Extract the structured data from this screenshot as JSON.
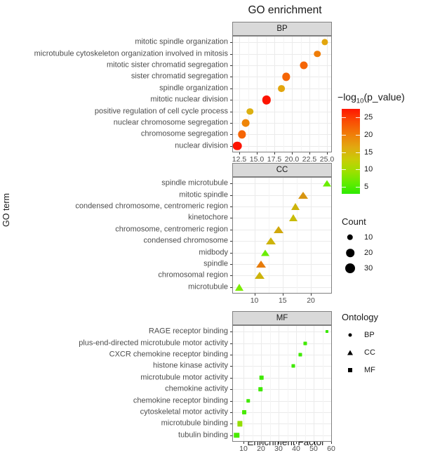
{
  "chart_data": {
    "type": "scatter",
    "title": "GO enrichment",
    "xlabel": "Enrichment Factor",
    "ylabel": "GO term",
    "grid": true,
    "facets": [
      {
        "name": "BP",
        "strip_label": "BP",
        "xlim": [
          11.6,
          25.6
        ],
        "xticks": [
          12.5,
          15.0,
          17.5,
          20.0,
          22.5,
          25.0
        ],
        "xtick_labels": [
          "12.5",
          "15.0",
          "17.5",
          "20.0",
          "22.5",
          "25.0"
        ],
        "points": [
          {
            "term": "mitotic spindle organization",
            "x": 24.7,
            "p": 20.0,
            "count": 12,
            "color": "#e2a60e"
          },
          {
            "term": "microtubule cytoskeleton organization involved in mitosis",
            "x": 23.6,
            "p": 21.5,
            "count": 13,
            "color": "#ef7d08"
          },
          {
            "term": "mitotic sister chromatid segregation",
            "x": 21.7,
            "p": 23.0,
            "count": 18,
            "color": "#f56505"
          },
          {
            "term": "sister chromatid segregation",
            "x": 19.2,
            "p": 23.0,
            "count": 19,
            "color": "#f56505"
          },
          {
            "term": "spindle organization",
            "x": 18.5,
            "p": 20.0,
            "count": 14,
            "color": "#e2a60e"
          },
          {
            "term": "mitotic nuclear division",
            "x": 16.4,
            "p": 27.0,
            "count": 23,
            "color": "#fd1400"
          },
          {
            "term": "positive regulation of cell cycle process",
            "x": 14.0,
            "p": 19.0,
            "count": 13,
            "color": "#dcb011"
          },
          {
            "term": "nuclear chromosome segregation",
            "x": 13.4,
            "p": 21.0,
            "count": 17,
            "color": "#ef8507"
          },
          {
            "term": "chromosome segregation",
            "x": 12.9,
            "p": 23.0,
            "count": 19,
            "color": "#f56505"
          },
          {
            "term": "nuclear division",
            "x": 12.2,
            "p": 27.0,
            "count": 24,
            "color": "#fd1400"
          }
        ]
      },
      {
        "name": "CC",
        "strip_label": "CC",
        "xlim": [
          6.2,
          23.6
        ],
        "xticks": [
          10,
          15,
          20
        ],
        "xtick_labels": [
          "10",
          "15",
          "20"
        ],
        "points": [
          {
            "term": "spindle microtubule",
            "x": 22.8,
            "p": 7.0,
            "count": 11,
            "color": "#6aed00"
          },
          {
            "term": "mitotic spindle",
            "x": 18.6,
            "p": 14.0,
            "count": 14,
            "color": "#d79510"
          },
          {
            "term": "condensed chromosome, centromeric region",
            "x": 17.2,
            "p": 12.5,
            "count": 13,
            "color": "#cdb30a"
          },
          {
            "term": "kinetochore",
            "x": 16.9,
            "p": 12.0,
            "count": 13,
            "color": "#c8bc08"
          },
          {
            "term": "chromosome, centromeric region",
            "x": 14.3,
            "p": 13.0,
            "count": 15,
            "color": "#d1a80c"
          },
          {
            "term": "condensed chromosome",
            "x": 12.9,
            "p": 12.5,
            "count": 14,
            "color": "#cdb30a"
          },
          {
            "term": "midbody",
            "x": 11.9,
            "p": 7.0,
            "count": 10,
            "color": "#6aed00"
          },
          {
            "term": "spindle",
            "x": 11.2,
            "p": 17.5,
            "count": 15,
            "color": "#e77b09"
          },
          {
            "term": "chromosomal region",
            "x": 10.9,
            "p": 12.5,
            "count": 15,
            "color": "#cdb30a"
          },
          {
            "term": "microtubule",
            "x": 7.3,
            "p": 8.0,
            "count": 13,
            "color": "#7bec00"
          }
        ]
      },
      {
        "name": "MF",
        "strip_label": "MF",
        "xlim": [
          4.0,
          60.0
        ],
        "xticks": [
          10,
          20,
          30,
          40,
          50,
          60
        ],
        "xtick_labels": [
          "10",
          "20",
          "30",
          "40",
          "50",
          "60"
        ],
        "points": [
          {
            "term": "RAGE receptor binding",
            "x": 57.5,
            "p": 4.0,
            "count": 3,
            "color": "#37e900"
          },
          {
            "term": "plus-end-directed microtubule motor activity",
            "x": 45.0,
            "p": 4.5,
            "count": 5,
            "color": "#3fe900"
          },
          {
            "term": "CXCR chemokine receptor binding",
            "x": 42.3,
            "p": 4.5,
            "count": 5,
            "color": "#3fe900"
          },
          {
            "term": "histone kinase activity",
            "x": 38.4,
            "p": 4.5,
            "count": 5,
            "color": "#3fe900"
          },
          {
            "term": "microtubule motor activity",
            "x": 20.3,
            "p": 4.5,
            "count": 9,
            "color": "#3fe900"
          },
          {
            "term": "chemokine activity",
            "x": 19.7,
            "p": 4.5,
            "count": 6,
            "color": "#3fe900"
          },
          {
            "term": "chemokine receptor binding",
            "x": 12.7,
            "p": 4.5,
            "count": 6,
            "color": "#3fe900"
          },
          {
            "term": "cytoskeletal motor activity",
            "x": 10.4,
            "p": 5.0,
            "count": 7,
            "color": "#48ea00"
          },
          {
            "term": "microtubule binding",
            "x": 8.0,
            "p": 8.5,
            "count": 11,
            "color": "#94de00"
          },
          {
            "term": "tubulin binding",
            "x": 6.1,
            "p": 5.0,
            "count": 12,
            "color": "#48ea00"
          }
        ]
      }
    ],
    "legends": {
      "color": {
        "title": "−log₁₀(p_value)",
        "title_parts": {
          "minus": "−",
          "log": "log",
          "sub": "10",
          "rest": "(p_value)"
        },
        "ticks": [
          25,
          20,
          15,
          10,
          5
        ],
        "tick_labels": [
          "25",
          "20",
          "15",
          "10",
          "5"
        ],
        "range": [
          3.0,
          27.5
        ],
        "low_color": "#2dea00",
        "high_color": "#fe1500"
      },
      "size": {
        "title": "Count",
        "breaks": [
          10,
          20,
          30
        ],
        "break_labels": [
          "10",
          "20",
          "30"
        ]
      },
      "shape": {
        "title": "Ontology",
        "items": [
          {
            "label": "BP",
            "shape": "circle"
          },
          {
            "label": "CC",
            "shape": "triangle"
          },
          {
            "label": "MF",
            "shape": "square"
          }
        ]
      }
    }
  }
}
